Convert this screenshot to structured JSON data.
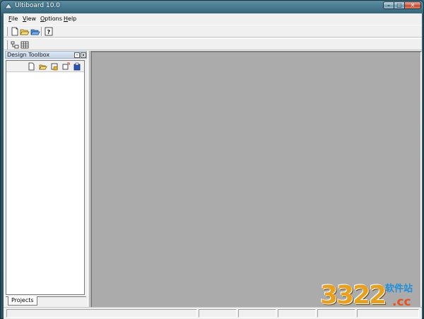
{
  "window": {
    "title": "Ultiboard 10.0",
    "caption_buttons": {
      "minimize": "–",
      "maximize": "□",
      "close": "✕"
    }
  },
  "menubar": {
    "items": [
      {
        "label": "File",
        "accel": "F",
        "rest": "ile"
      },
      {
        "label": "View",
        "accel": "V",
        "rest": "iew"
      },
      {
        "label": "Options",
        "accel": "O",
        "rest": "ptions"
      },
      {
        "label": "Help",
        "accel": "H",
        "rest": "elp"
      }
    ]
  },
  "toolbar1": {
    "buttons": [
      {
        "icon": "new-file-icon"
      },
      {
        "icon": "open-folder-icon"
      },
      {
        "icon": "open-project-icon"
      },
      {
        "icon": "help-icon"
      }
    ]
  },
  "toolbar2": {
    "buttons": [
      {
        "icon": "toolbox-tree-icon"
      },
      {
        "icon": "spreadsheet-icon"
      }
    ]
  },
  "toolbox": {
    "title": "Design Toolbox",
    "min_label": "-",
    "close_label": "x",
    "tools": [
      {
        "icon": "new-project-icon"
      },
      {
        "icon": "open-project-icon"
      },
      {
        "icon": "save-project-icon"
      },
      {
        "icon": "close-project-icon"
      },
      {
        "icon": "project-properties-icon"
      }
    ],
    "tabs": [
      {
        "label": "Projects",
        "active": true
      }
    ]
  },
  "workspace": {
    "background": "#ababab"
  },
  "watermark": {
    "number": "3322",
    "site": "软件站",
    "domain": ".cc"
  },
  "colors": {
    "chrome": "#f0f0f0",
    "workspace": "#ababab",
    "titlebar": "#3f6f85"
  }
}
